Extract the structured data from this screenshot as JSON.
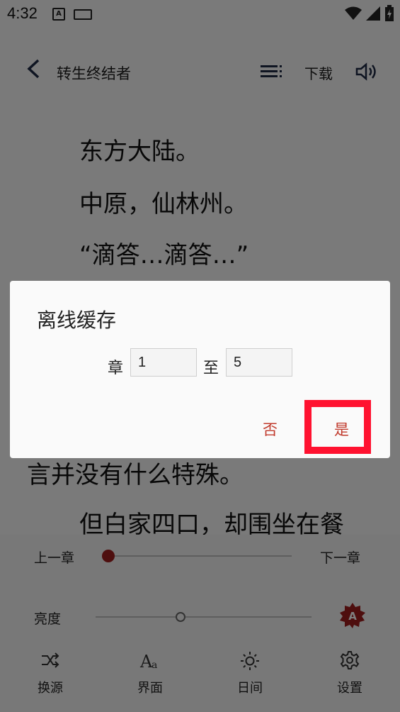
{
  "status": {
    "time": "4:32"
  },
  "header": {
    "title": "转生终结者",
    "download": "下载"
  },
  "content": {
    "lines": [
      "东方大陆。",
      "中原，仙林州。",
      "“滴答…滴答…”",
      "言并没有什么特殊。",
      "但白家四口，却围坐在餐"
    ]
  },
  "controls": {
    "prev_chapter": "上一章",
    "next_chapter": "下一章",
    "brightness": "亮度",
    "chapter_progress": 0,
    "brightness_level": 0.39,
    "nav": [
      {
        "label": "换源",
        "icon": "swap-source-icon"
      },
      {
        "label": "界面",
        "icon": "font-style-icon"
      },
      {
        "label": "日间",
        "icon": "sun-icon"
      },
      {
        "label": "设置",
        "icon": "settings-gear-icon"
      }
    ]
  },
  "dialog": {
    "title": "离线缓存",
    "from_label": "章",
    "from_value": "1",
    "to_label": "至",
    "to_value": "5",
    "no": "否",
    "yes": "是"
  },
  "colors": {
    "accent": "#c0392b",
    "highlight": "#ff1230",
    "thumb": "#9c1c1c"
  }
}
